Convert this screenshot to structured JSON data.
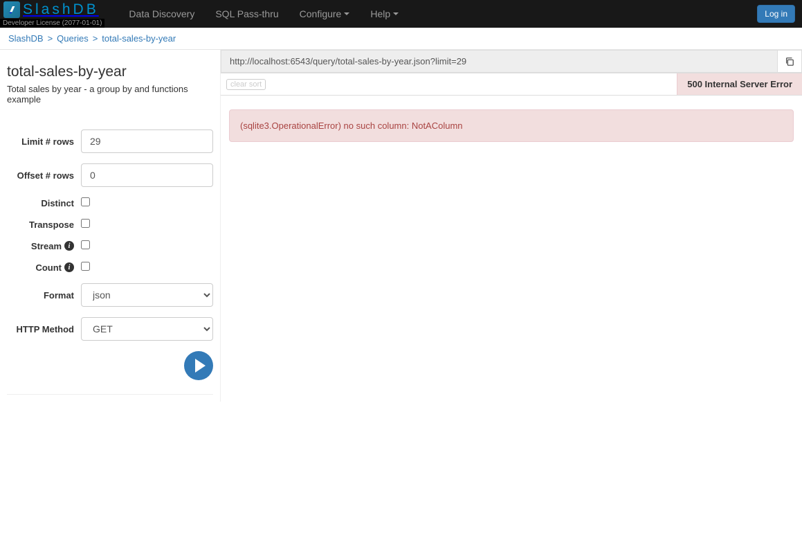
{
  "navbar": {
    "logo_text": "SlashDB",
    "license": "Developer License (2077-01-01)",
    "links": {
      "data_discovery": "Data Discovery",
      "sql_passthru": "SQL Pass-thru",
      "configure": "Configure",
      "help": "Help"
    },
    "login": "Log in"
  },
  "breadcrumb": {
    "root": "SlashDB",
    "queries": "Queries",
    "current": "total-sales-by-year"
  },
  "page": {
    "title": "total-sales-by-year",
    "description": "Total sales by year - a group by and functions example"
  },
  "form": {
    "limit_label": "Limit # rows",
    "limit_value": "29",
    "offset_label": "Offset # rows",
    "offset_value": "0",
    "distinct_label": "Distinct",
    "transpose_label": "Transpose",
    "stream_label": "Stream",
    "count_label": "Count",
    "format_label": "Format",
    "format_value": "json",
    "method_label": "HTTP Method",
    "method_value": "GET"
  },
  "content": {
    "url": "http://localhost:6543/query/total-sales-by-year.json?limit=29",
    "clear_sort": "clear sort",
    "status": "500 Internal Server Error",
    "error": "(sqlite3.OperationalError) no such column: NotAColumn"
  }
}
